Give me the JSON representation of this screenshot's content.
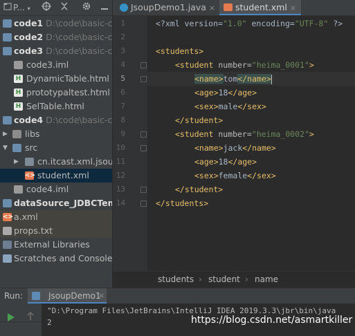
{
  "project_toolbar": {
    "view_label": "P...",
    "view_dropdown_icon": "chevron-down-icon",
    "locate_icon": "crosshair-icon",
    "collapse_icon": "collapse-all-icon",
    "settings_icon": "gear-icon",
    "hide_icon": "minimize-icon"
  },
  "tree": [
    {
      "label": "code1",
      "path": "D:\\code\\basic-co",
      "kind": "module"
    },
    {
      "label": "code2",
      "path": "D:\\code\\basic-co",
      "kind": "module"
    },
    {
      "label": "code3",
      "path": "D:\\code\\basic-co",
      "kind": "module"
    },
    {
      "label": "code3.iml",
      "kind": "iml"
    },
    {
      "label": "DynamicTable.html",
      "kind": "html"
    },
    {
      "label": "prototypaltest.html",
      "kind": "html"
    },
    {
      "label": "SelTable.html",
      "kind": "html"
    },
    {
      "label": "code4",
      "path": "D:\\code\\basic-co",
      "kind": "module"
    },
    {
      "label": "libs",
      "kind": "folder"
    },
    {
      "label": "src",
      "kind": "folder"
    },
    {
      "label": "cn.itcast.xml.jsoup",
      "kind": "package"
    },
    {
      "label": "student.xml",
      "kind": "xml"
    },
    {
      "label": "code4.iml",
      "kind": "iml"
    },
    {
      "label": "dataSource_JDBCTempl",
      "kind": "module"
    },
    {
      "label": "a.xml",
      "kind": "xml"
    },
    {
      "label": "props.txt",
      "kind": "txt"
    },
    {
      "label": "External Libraries",
      "kind": "libraries"
    },
    {
      "label": "Scratches and Consoles",
      "kind": "scratches"
    }
  ],
  "tabs": [
    {
      "label": "JsoupDemo1.java",
      "close": "×",
      "active": false
    },
    {
      "label": "student.xml",
      "close": "×",
      "active": true
    }
  ],
  "line_numbers": [
    "1",
    "2",
    "3",
    "4",
    "5",
    "6",
    "7",
    "8",
    "9",
    "10",
    "11",
    "12",
    "13",
    "14"
  ],
  "code": {
    "l1_a": "<?xml version=",
    "l1_b": "\"1.0\"",
    "l1_c": " encoding=",
    "l1_d": "\"UTF-8\"",
    "l1_e": " ?>",
    "l3": "<students>",
    "l4_open": "<student",
    "l4_attr": " number=",
    "l4_val": "\"heima_0001\"",
    "l4_close": ">",
    "name_open": "<name>",
    "name_close": "</name>",
    "l5_text": "tom",
    "age_open": "<age>",
    "age_close": "</age>",
    "l6_text": "18",
    "sex_open": "<sex>",
    "sex_close": "</sex>",
    "l7_text": "male",
    "student_close": "</student>",
    "l9_val": "\"heima_0002\"",
    "l10_text": "jack",
    "l11_text": "18",
    "l12_text": "female",
    "l14": "</students>"
  },
  "breadcrumbs": [
    "students",
    "student",
    "name"
  ],
  "breadcrumb_sep": "›",
  "run": {
    "label": "Run:",
    "config": "JsoupDemo1",
    "close": "×",
    "output": [
      "\"D:\\Program Files\\JetBrains\\IntelliJ IDEA 2019.3.3\\jbr\\bin\\java",
      "2"
    ]
  },
  "watermark": "https://blog.csdn.net/asmartkiller"
}
